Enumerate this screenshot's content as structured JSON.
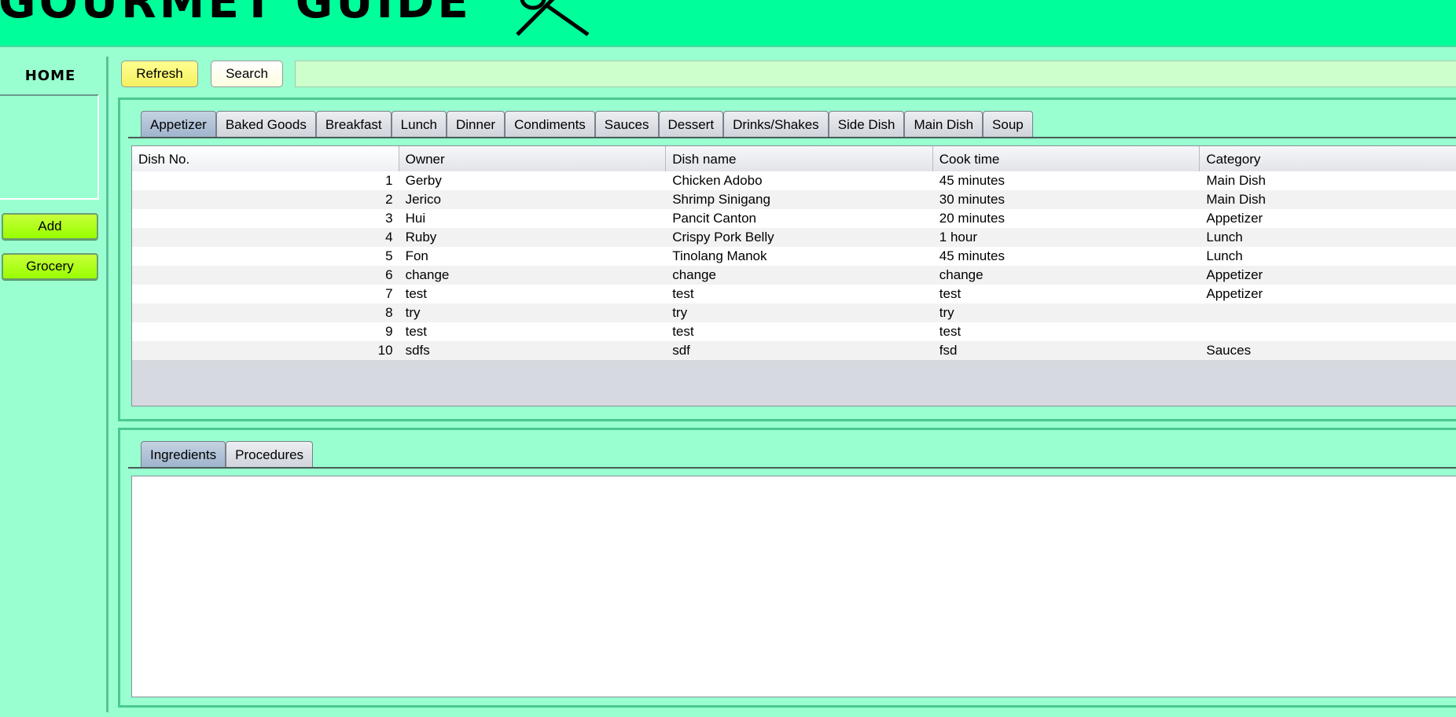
{
  "app": {
    "title": "GOURMET GUIDE",
    "logo_icon": "fork-spoon-icon"
  },
  "sidebar": {
    "home_label": "HOME",
    "add_label": "Add",
    "grocery_label": "Grocery"
  },
  "toolbar": {
    "refresh_label": "Refresh",
    "search_label": "Search",
    "search_value": ""
  },
  "category_tabs": [
    {
      "label": "Appetizer",
      "active": true
    },
    {
      "label": "Baked Goods"
    },
    {
      "label": "Breakfast"
    },
    {
      "label": "Lunch"
    },
    {
      "label": "Dinner"
    },
    {
      "label": "Condiments"
    },
    {
      "label": "Sauces"
    },
    {
      "label": "Dessert"
    },
    {
      "label": "Drinks/Shakes"
    },
    {
      "label": "Side Dish"
    },
    {
      "label": "Main Dish"
    },
    {
      "label": "Soup"
    }
  ],
  "table": {
    "columns": [
      "Dish No.",
      "Owner",
      "Dish name",
      "Cook time",
      "Category"
    ],
    "rows": [
      [
        "1",
        "Gerby",
        "Chicken Adobo",
        "45 minutes",
        "Main Dish"
      ],
      [
        "2",
        "Jerico",
        "Shrimp Sinigang",
        "30 minutes",
        "Main Dish"
      ],
      [
        "3",
        "Hui",
        "Pancit Canton",
        "20 minutes",
        "Appetizer"
      ],
      [
        "4",
        "Ruby",
        "Crispy Pork Belly",
        "1 hour",
        "Lunch"
      ],
      [
        "5",
        "Fon",
        "Tinolang Manok",
        "45 minutes",
        "Lunch"
      ],
      [
        "6",
        "change",
        "change",
        "change",
        "Appetizer"
      ],
      [
        "7",
        "test",
        "test",
        "test",
        "Appetizer"
      ],
      [
        "8",
        "try",
        "try",
        "try",
        ""
      ],
      [
        "9",
        "test",
        "test",
        "test",
        ""
      ],
      [
        "10",
        "sdfs",
        "sdf",
        "fsd",
        "Sauces"
      ]
    ]
  },
  "detail_tabs": [
    {
      "label": "Ingredients",
      "active": true
    },
    {
      "label": "Procedures"
    }
  ],
  "colors": {
    "header_bg": "#00fe9a",
    "page_bg": "#99ffd0",
    "side_button": "#99ff00",
    "refresh_button": "#f4f060"
  }
}
